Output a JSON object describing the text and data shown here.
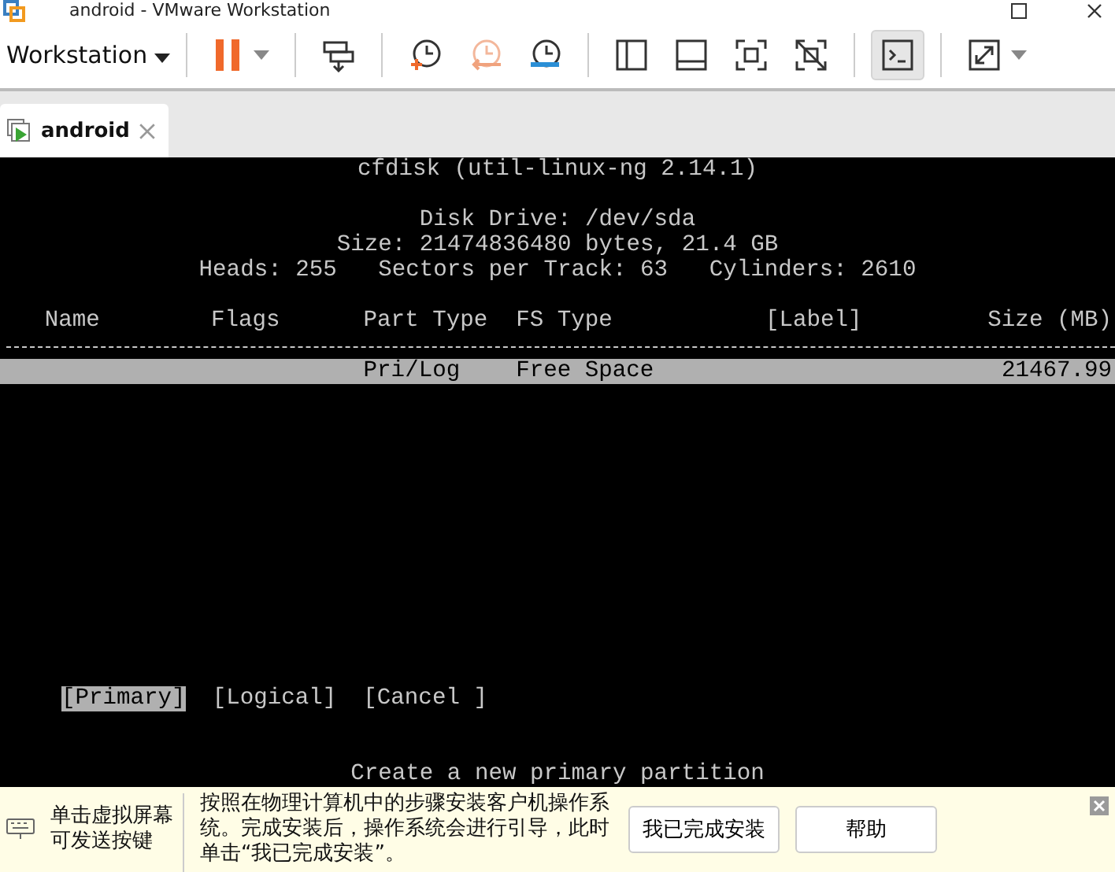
{
  "window": {
    "title": "android - VMware Workstation"
  },
  "toolbar": {
    "menu": "Workstation",
    "buttons": [
      {
        "kind": "pause",
        "pressed": false,
        "caret": true
      },
      {
        "kind": "send-keys",
        "pressed": false,
        "caret": false
      },
      {
        "kind": "snapshot-take",
        "pressed": false,
        "caret": false
      },
      {
        "kind": "snapshot-revert",
        "pressed": false,
        "caret": false
      },
      {
        "kind": "snapshot-manage",
        "pressed": false,
        "caret": false
      },
      {
        "kind": "library",
        "pressed": false,
        "caret": false
      },
      {
        "kind": "thumbnail",
        "pressed": false,
        "caret": false
      },
      {
        "kind": "fullscreen",
        "pressed": false,
        "caret": false
      },
      {
        "kind": "unity",
        "pressed": false,
        "caret": false
      },
      {
        "kind": "console",
        "pressed": true,
        "caret": false
      },
      {
        "kind": "stretch",
        "pressed": false,
        "caret": true
      }
    ]
  },
  "tabs": [
    {
      "label": "android",
      "selected": true
    }
  ],
  "console": {
    "title": "cfdisk (util-linux-ng 2.14.1)",
    "disk_info": [
      "Disk Drive: /dev/sda",
      "Size: 21474836480 bytes, 21.4 GB",
      "Heads: 255   Sectors per Track: 63   Cylinders: 2610"
    ],
    "columns": [
      "Name",
      "Flags",
      "Part Type",
      "FS Type",
      "[Label]",
      "Size (MB)"
    ],
    "partitions": [
      {
        "part_type": "Pri/Log",
        "fs_type": "Free Space",
        "size": "21467.99",
        "selected": true
      }
    ],
    "actions": [
      {
        "label": "[Primary]",
        "selected": true
      },
      {
        "label": "[Logical]",
        "selected": false
      },
      {
        "label": "[Cancel ]",
        "selected": false
      }
    ],
    "message": "Create a new primary partition"
  },
  "hint_bar": {
    "click_hint": "单击虚拟屏幕可发送按键",
    "message": "按照在物理计算机中的步骤安装客户机操作系统。完成安装后，操作系统会进行引导，此时单击“我已完成安装”。",
    "buttons": [
      "我已完成安装",
      "帮助"
    ]
  }
}
